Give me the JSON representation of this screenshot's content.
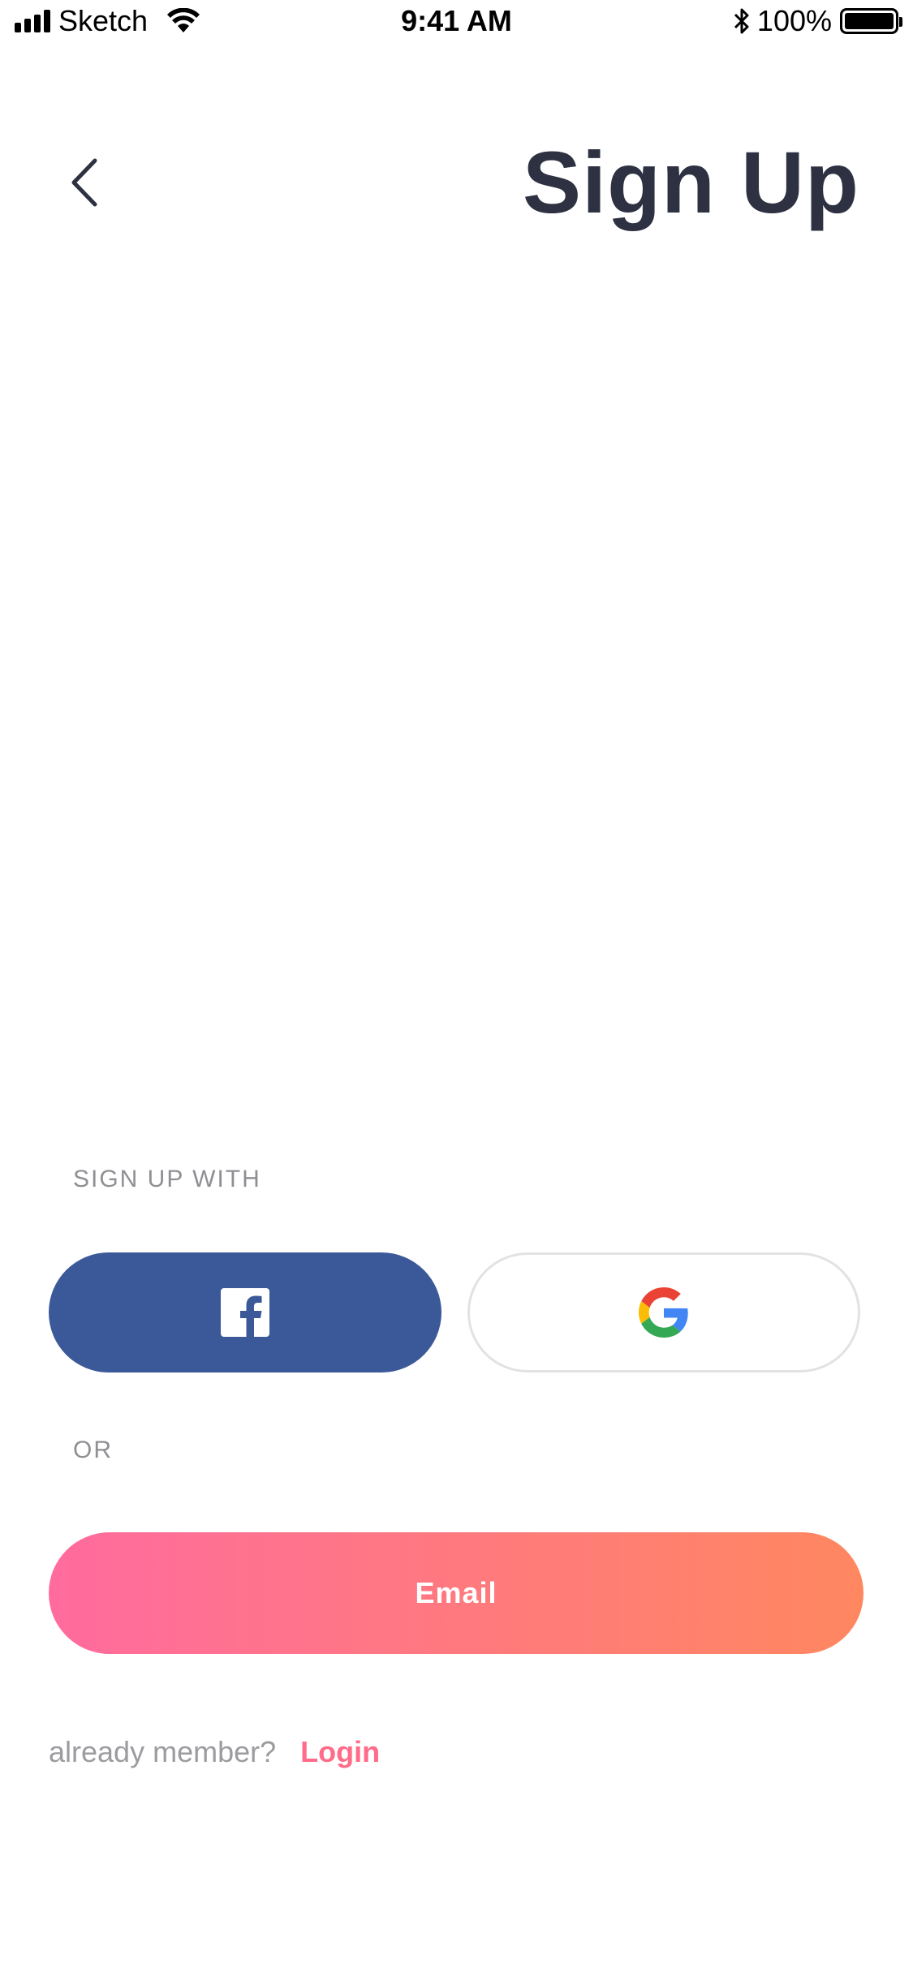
{
  "status_bar": {
    "carrier": "Sketch",
    "time": "9:41 AM",
    "battery": "100%",
    "battery_level": 1.0,
    "signal_bars": 4
  },
  "header": {
    "back_icon": "chevron-left-icon",
    "title": "Sign Up"
  },
  "signup_section": {
    "label": "SIGN UP WITH",
    "facebook_icon": "facebook-icon",
    "google_icon": "google-icon"
  },
  "or_label": "OR",
  "email_button": {
    "label": "Email"
  },
  "footer": {
    "prompt": "already member?",
    "login_label": "Login"
  },
  "colors": {
    "title": "#2d3142",
    "facebook": "#3b5998",
    "gradient_start": "#ff6b9e",
    "gradient_end": "#ff8760",
    "login_link": "#ff6b88",
    "muted_text": "#8f8f94"
  }
}
